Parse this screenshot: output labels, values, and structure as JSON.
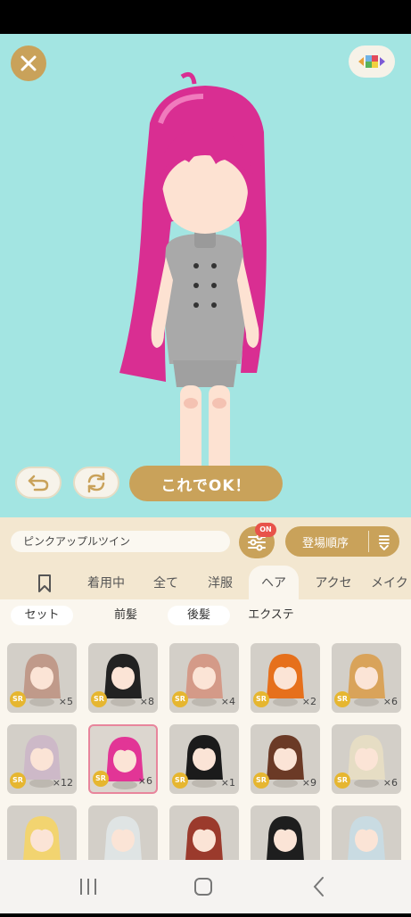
{
  "stage": {
    "ok_label": "これでOK！"
  },
  "costume_name": "ピンクアップルツイン",
  "filter": {
    "badge": "ON"
  },
  "sort": {
    "label": "登場順序"
  },
  "tabs": [
    "着用中",
    "全て",
    "洋服",
    "ヘア",
    "アクセ",
    "メイク"
  ],
  "subtabs": [
    "セット",
    "前髪",
    "後髪",
    "エクステ"
  ],
  "items": [
    {
      "rarity": "SR",
      "count": "×5",
      "hair": "#c09a8a"
    },
    {
      "rarity": "SR",
      "count": "×8",
      "hair": "#222222"
    },
    {
      "rarity": "SR",
      "count": "×4",
      "hair": "#d49a88"
    },
    {
      "rarity": "SR",
      "count": "×2",
      "hair": "#e6701c"
    },
    {
      "rarity": "SR",
      "count": "×6",
      "hair": "#d9a35a"
    },
    {
      "rarity": "SR",
      "count": "×12",
      "hair": "#cdb9c8"
    },
    {
      "rarity": "SR",
      "count": "×6",
      "hair": "#e23596"
    },
    {
      "rarity": "SR",
      "count": "×1",
      "hair": "#1b1b1b"
    },
    {
      "rarity": "SR",
      "count": "×9",
      "hair": "#6b3a26"
    },
    {
      "rarity": "SR",
      "count": "×6",
      "hair": "#e6ddc4"
    },
    {
      "rarity": "",
      "count": "",
      "hair": "#f2d470"
    },
    {
      "rarity": "",
      "count": "",
      "hair": "#dfe4e4"
    },
    {
      "rarity": "",
      "count": "",
      "hair": "#9b3a2c"
    },
    {
      "rarity": "",
      "count": "",
      "hair": "#1e1e1e"
    },
    {
      "rarity": "",
      "count": "",
      "hair": "#c9dbe2"
    }
  ],
  "colors": {
    "stage_bg": "#a3e5e2",
    "gold": "#c9a25a",
    "hair_pink": "#e23596",
    "badge_red": "#e8534a"
  }
}
